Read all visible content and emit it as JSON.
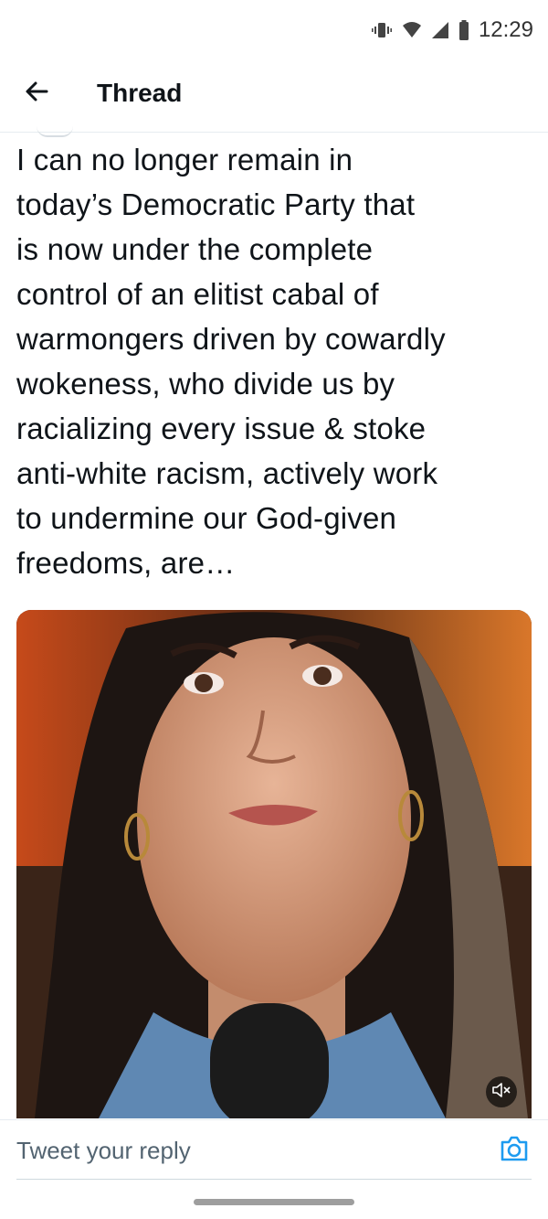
{
  "status_bar": {
    "time": "12:29",
    "icons": [
      "vibrate-icon",
      "wifi-icon",
      "signal-icon",
      "battery-icon"
    ]
  },
  "header": {
    "back_icon": "arrow-left-icon",
    "title": "Thread"
  },
  "tweet": {
    "text": "I can no longer remain in\ntoday’s Democratic Party that\nis now under the complete\ncontrol of an elitist cabal of\nwarmongers driven by cowardly\nwokeness, who divide us by\nracializing every issue & stoke\nanti-white racism, actively work\nto undermine our God-given\nfreedoms, are…",
    "media": {
      "kind": "video",
      "mute_icon": "speaker-muted-icon"
    }
  },
  "reply": {
    "placeholder": "Tweet your reply",
    "camera_icon": "camera-icon"
  },
  "colors": {
    "accent": "#1d9bf0",
    "text": "#0f1419",
    "muted": "#536471",
    "divider": "#e6ecf0"
  }
}
